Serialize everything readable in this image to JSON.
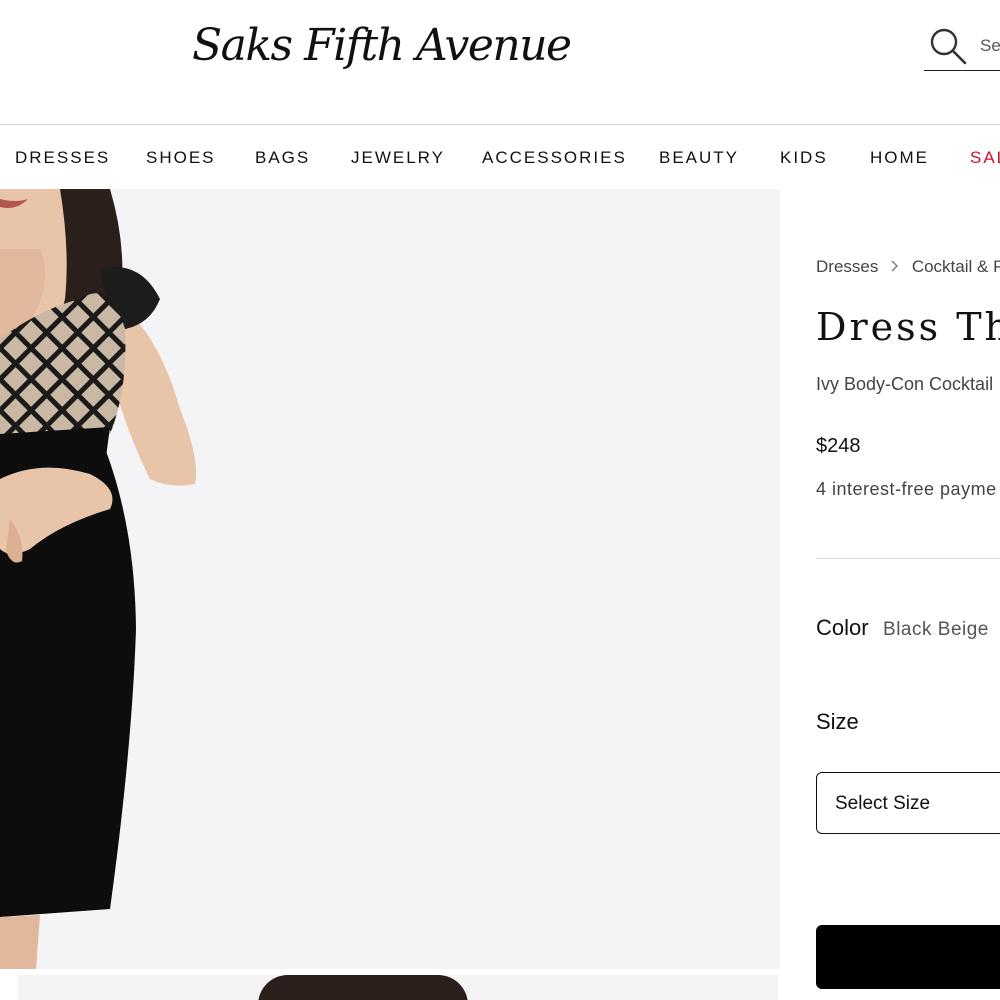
{
  "header": {
    "logo": "Saks Fifth Avenue",
    "search_placeholder": "Se"
  },
  "nav": {
    "items": [
      "DRESSES",
      "SHOES",
      "BAGS",
      "JEWELRY",
      "ACCESSORIES",
      "BEAUTY",
      "KIDS",
      "HOME",
      "SAL"
    ]
  },
  "product": {
    "breadcrumb": [
      "Dresses",
      "Cocktail & Pa"
    ],
    "brand": "Dress The",
    "name": "Ivy Body-Con Cocktail",
    "price": "$248",
    "installments": "4 interest-free payme",
    "color_label": "Color",
    "color_value": "Black Beige",
    "size_label": "Size",
    "size_select": "Select Size",
    "add_to_bag_label": ""
  },
  "colors": {
    "sale": "#c8102e",
    "image_bg": "#f4f4f6",
    "dress_black": "#0d0d0d"
  },
  "icons": {
    "search": "search-icon",
    "chevron": "chevron-right-icon"
  }
}
